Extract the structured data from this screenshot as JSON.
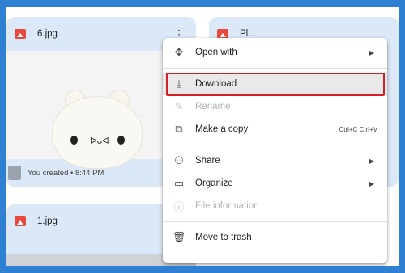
{
  "files": [
    {
      "name": "6.jpg",
      "footer": "You created • 8:44 PM"
    },
    {
      "name": "Pl..."
    },
    {
      "name": "1.jpg"
    }
  ],
  "menu": {
    "items": [
      {
        "label": "Open with",
        "icon": "move-arrows-icon",
        "glyph": "✥",
        "submenu": true,
        "disabled": false
      },
      {
        "label": "Download",
        "icon": "download-icon",
        "glyph": "⤓",
        "highlighted": true,
        "disabled": false
      },
      {
        "label": "Rename",
        "icon": "pencil-icon",
        "glyph": "✎",
        "disabled": true
      },
      {
        "label": "Make a copy",
        "icon": "copy-icon",
        "glyph": "⧉",
        "shortcut": "Ctrl+C Ctrl+V",
        "disabled": false
      },
      {
        "label": "Share",
        "icon": "person-add-icon",
        "glyph": "⚇",
        "submenu": true,
        "disabled": false
      },
      {
        "label": "Organize",
        "icon": "folder-icon",
        "glyph": "▭",
        "submenu": true,
        "disabled": false
      },
      {
        "label": "File information",
        "icon": "info-icon",
        "glyph": "ⓘ",
        "disabled": true
      },
      {
        "label": "Move to trash",
        "icon": "trash-icon",
        "glyph": "🗑",
        "disabled": false
      }
    ],
    "submenu_arrow": "▶"
  },
  "colors": {
    "background": "#2f7fd3",
    "highlight_border": "#d51f24",
    "card": "#dbe8f7"
  }
}
